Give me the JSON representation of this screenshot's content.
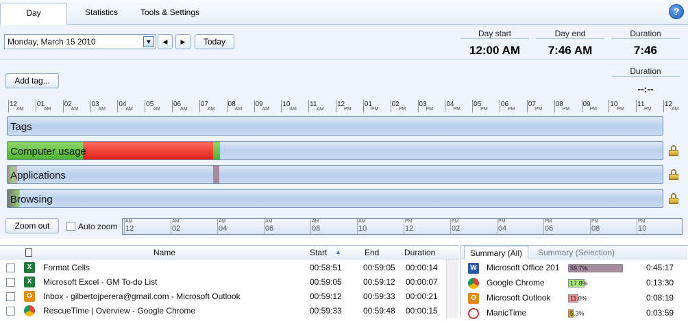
{
  "tabs": [
    "Day",
    "Statistics",
    "Tools & Settings"
  ],
  "date": {
    "value": "Monday, March 15 2010",
    "today_label": "Today",
    "prev_label": "◀",
    "next_label": "▶"
  },
  "summary_header": {
    "day_start_label": "Day start",
    "day_start_value": "12:00 AM",
    "day_end_label": "Day end",
    "day_end_value": "7:46 AM",
    "duration_label": "Duration",
    "duration_value": "7:46"
  },
  "timeline": {
    "add_tag_label": "Add tag...",
    "duration_label": "Duration",
    "duration_value": "--:--",
    "axis_hours": [
      "12",
      "01",
      "02",
      "03",
      "04",
      "05",
      "06",
      "07",
      "08",
      "09",
      "10",
      "11",
      "12",
      "01",
      "02",
      "03",
      "04",
      "05",
      "06",
      "07",
      "08",
      "09",
      "10",
      "11",
      "12"
    ],
    "axis_suffix": [
      "AM",
      "AM",
      "AM",
      "AM",
      "AM",
      "AM",
      "AM",
      "AM",
      "AM",
      "AM",
      "AM",
      "AM",
      "PM",
      "PM",
      "PM",
      "PM",
      "PM",
      "PM",
      "PM",
      "PM",
      "PM",
      "PM",
      "PM",
      "PM",
      "AM"
    ],
    "rows": [
      "Tags",
      "Computer usage",
      "Applications",
      "Browsing"
    ],
    "zoom_out_label": "Zoom out",
    "auto_zoom_label": "Auto zoom",
    "mini_axis": [
      {
        "suffix": "AM",
        "hour": "12"
      },
      {
        "suffix": "AM",
        "hour": "02"
      },
      {
        "suffix": "AM",
        "hour": "04"
      },
      {
        "suffix": "AM",
        "hour": "06"
      },
      {
        "suffix": "AM",
        "hour": "08"
      },
      {
        "suffix": "AM",
        "hour": "10"
      },
      {
        "suffix": "PM",
        "hour": "12"
      },
      {
        "suffix": "PM",
        "hour": "02"
      },
      {
        "suffix": "PM",
        "hour": "04"
      },
      {
        "suffix": "PM",
        "hour": "06"
      },
      {
        "suffix": "PM",
        "hour": "08"
      },
      {
        "suffix": "PM",
        "hour": "10"
      }
    ]
  },
  "table": {
    "headers": {
      "name": "Name",
      "start": "Start",
      "end": "End",
      "duration": "Duration"
    },
    "rows": [
      {
        "icon": "excel-icon",
        "name": "Format Cells",
        "start": "00:58:51",
        "end": "00:59:05",
        "duration": "00:00:14"
      },
      {
        "icon": "excel-icon",
        "name": "Microsoft Excel - GM To-do List",
        "start": "00:59:05",
        "end": "00:59:12",
        "duration": "00:00:07"
      },
      {
        "icon": "outlook-icon",
        "name": "Inbox - gilbertojperera@gmail.com - Microsoft Outlook",
        "start": "00:59:12",
        "end": "00:59:33",
        "duration": "00:00:21"
      },
      {
        "icon": "chrome-icon",
        "name": "RescueTime | Overview - Google Chrome",
        "start": "00:59:33",
        "end": "00:59:48",
        "duration": "00:00:15"
      }
    ]
  },
  "summary": {
    "tab_all": "Summary (All)",
    "tab_selection": "Summary (Selection)",
    "rows": [
      {
        "icon": "word-icon",
        "name": "Microsoft Office 201",
        "percent": 59.7,
        "percent_label": "59.7%",
        "time": "0:45:17",
        "color": "#a58aa0"
      },
      {
        "icon": "chrome-icon",
        "name": "Google Chrome",
        "percent": 17.8,
        "percent_label": "17.8%",
        "time": "0:13:30",
        "color": "#a6e87a"
      },
      {
        "icon": "outlook-icon",
        "name": "Microsoft Outlook",
        "percent": 11.0,
        "percent_label": "11.0%",
        "time": "0:08:19",
        "color": "#ee8d8d"
      },
      {
        "icon": "manictime-icon",
        "name": "ManicTime",
        "percent": 5.3,
        "percent_label": "5.3%",
        "time": "0:03:59",
        "color": "#c8a02a"
      }
    ]
  }
}
